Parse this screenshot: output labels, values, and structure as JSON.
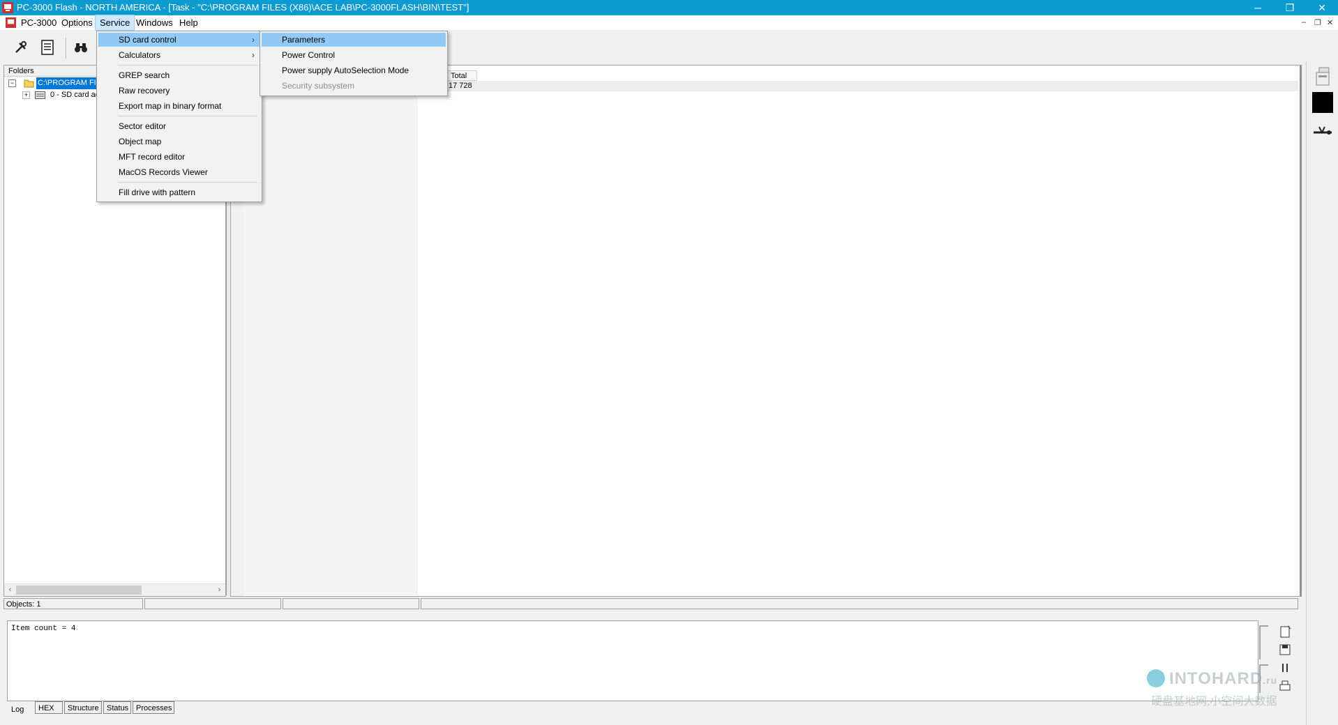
{
  "window": {
    "title": "PC-3000 Flash - NORTH AMERICA - [Task - \"C:\\PROGRAM FILES (X86)\\ACE LAB\\PC-3000FLASH\\BIN\\TEST\"]",
    "controls": {
      "minimize": "─",
      "restore": "❐",
      "close": "✕"
    }
  },
  "menubar": {
    "items": [
      "PC-3000",
      "Options",
      "Service",
      "Windows",
      "Help"
    ],
    "mdi_controls": {
      "minimize": "–",
      "restore": "❐",
      "close": "✕"
    }
  },
  "service_menu": {
    "items": [
      {
        "label": "SD card control",
        "submenu": true
      },
      {
        "label": "Calculators",
        "submenu": true
      },
      {
        "label": "GREP search"
      },
      {
        "label": "Raw recovery"
      },
      {
        "label": "Export map in binary format"
      },
      {
        "label": "Sector editor"
      },
      {
        "label": "Object map"
      },
      {
        "label": "MFT record editor"
      },
      {
        "label": "MacOS Records Viewer"
      },
      {
        "label": "Fill drive with pattern"
      }
    ],
    "arrow": "›"
  },
  "sd_card_submenu": {
    "items": [
      {
        "label": "Parameters"
      },
      {
        "label": "Power Control"
      },
      {
        "label": "Power supply AutoSelection Mode"
      },
      {
        "label": "Security subsystem",
        "disabled": true
      }
    ]
  },
  "folders": {
    "header": "Folders",
    "tree": [
      {
        "label": "C:\\PROGRAM FIL",
        "toggle": "−",
        "selected": true
      },
      {
        "label": "0 - SD card ad",
        "toggle": "+"
      }
    ],
    "scroll_left": "‹",
    "scroll_right": "›"
  },
  "table": {
    "column": "Total",
    "value": "17 728"
  },
  "statusbar": {
    "objects": "Objects: 1"
  },
  "log": {
    "text": "Item count = 4"
  },
  "tabs": [
    "Log",
    "HEX",
    "Structure",
    "Status",
    "Processes"
  ],
  "watermark": {
    "brand": "INTOHARD",
    "domain": ".ru",
    "tagline": "硬盘基地网,小空间大数据"
  },
  "colors": {
    "titlebar": "#0a9bd1",
    "menu_highlight": "#91c9f7",
    "tree_selected": "#0078d7"
  }
}
